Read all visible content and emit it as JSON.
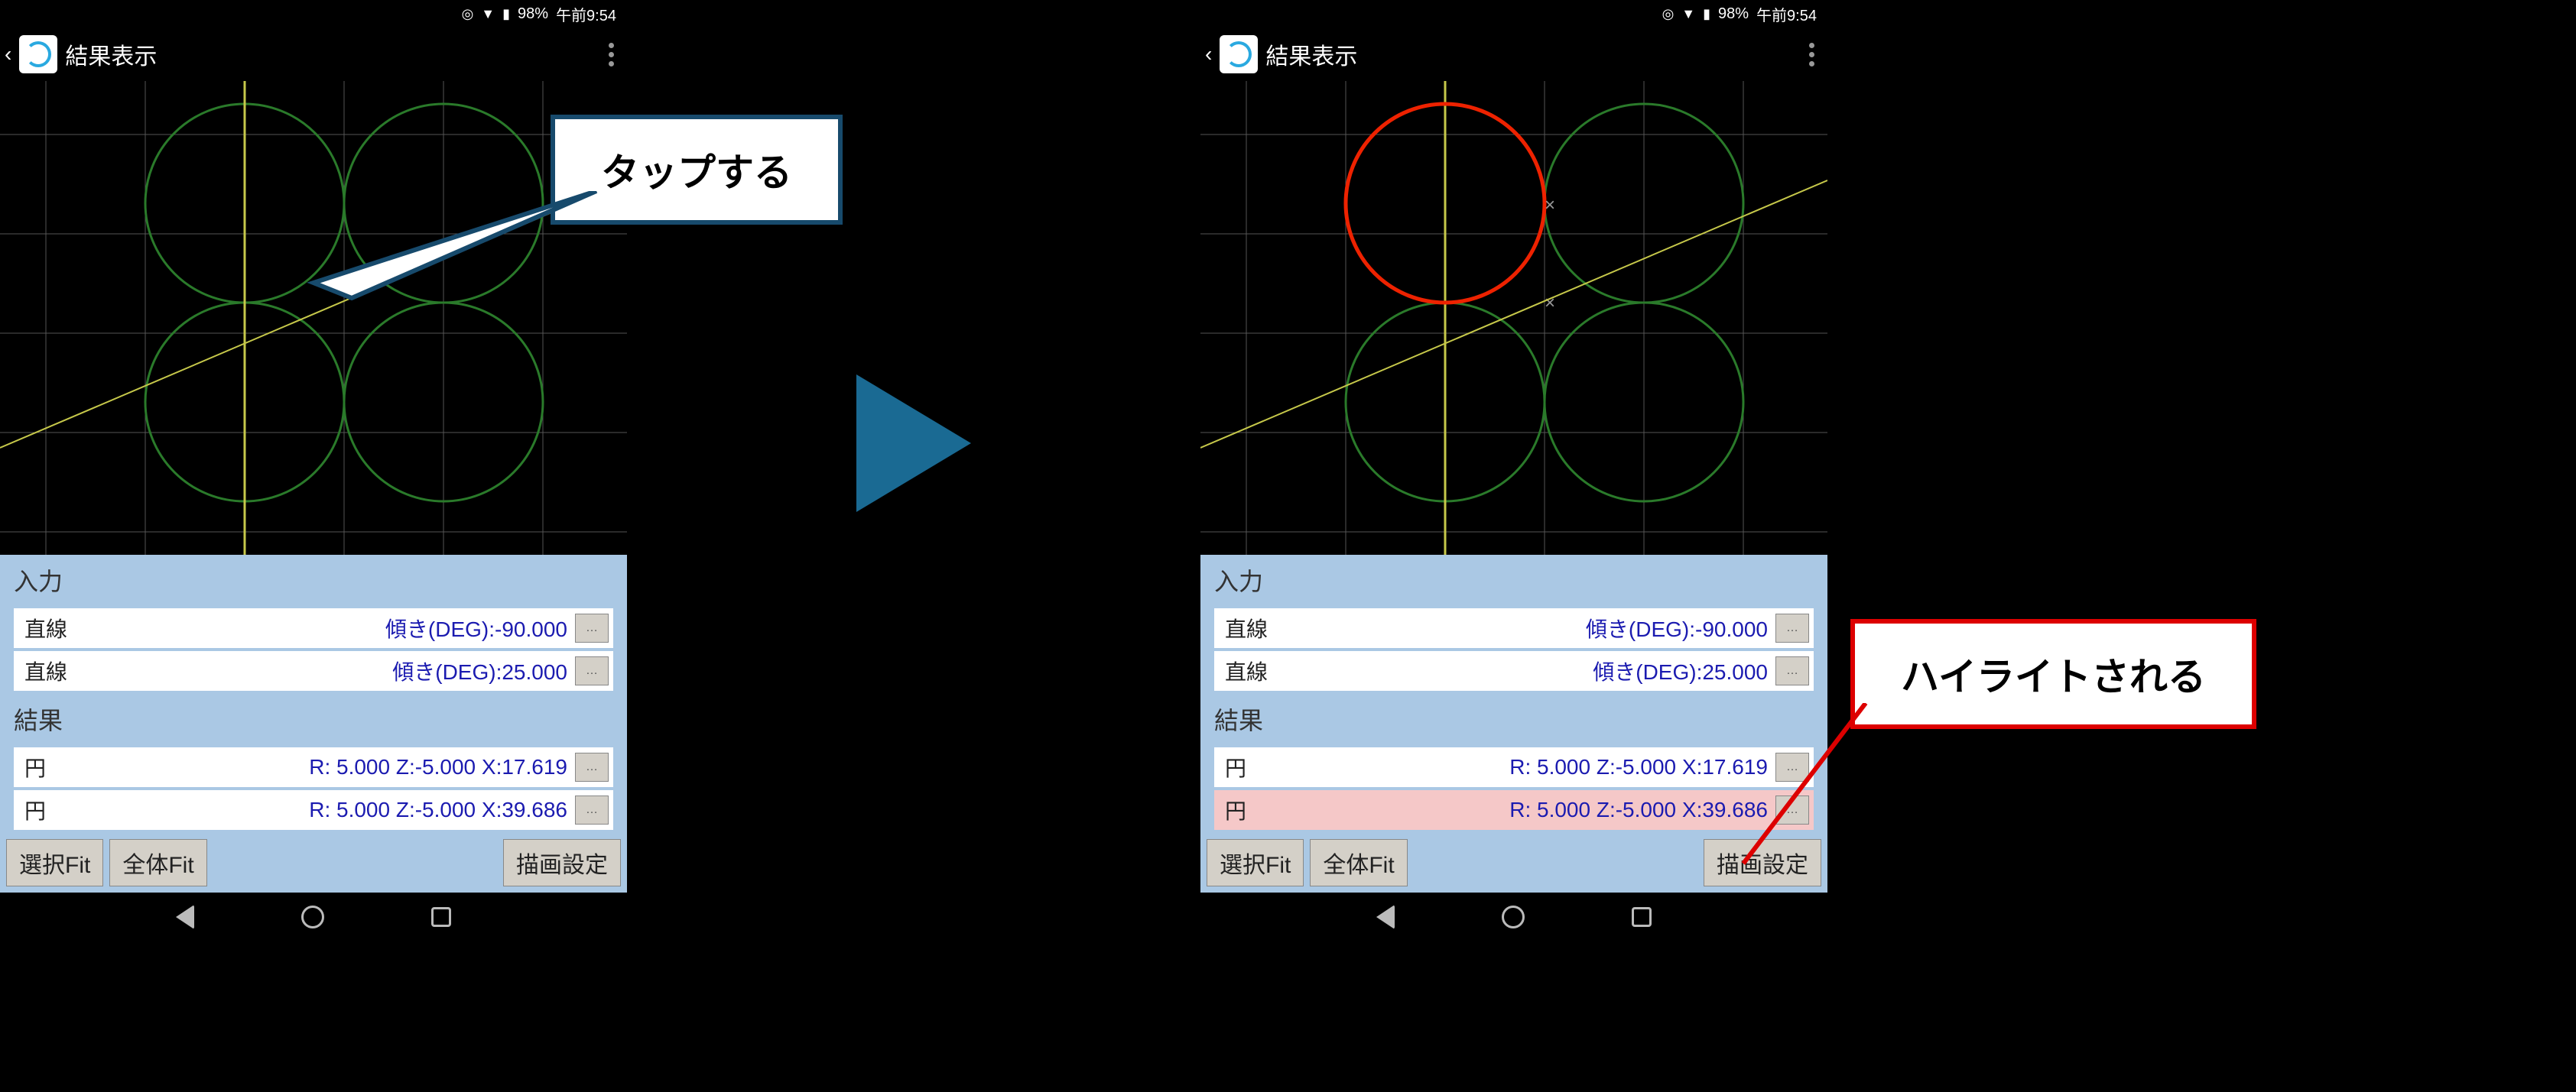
{
  "status": {
    "battery": "98%",
    "time": "午前9:54"
  },
  "appbar": {
    "title": "結果表示"
  },
  "sections": {
    "input": "入力",
    "result": "結果"
  },
  "rows": {
    "line1": {
      "label": "直線",
      "val": "傾き(DEG):-90.000"
    },
    "line2": {
      "label": "直線",
      "val": "傾き(DEG):25.000"
    },
    "circ1": {
      "label": "円",
      "val": "R: 5.000 Z:-5.000 X:17.619"
    },
    "circ2": {
      "label": "円",
      "val": "R: 5.000 Z:-5.000 X:39.686"
    }
  },
  "buttons": {
    "selfit": "選択Fit",
    "allfit": "全体Fit",
    "draw": "描画設定",
    "ellipsis": "…"
  },
  "callout": {
    "tap": "タップする",
    "highlight": "ハイライトされる"
  }
}
